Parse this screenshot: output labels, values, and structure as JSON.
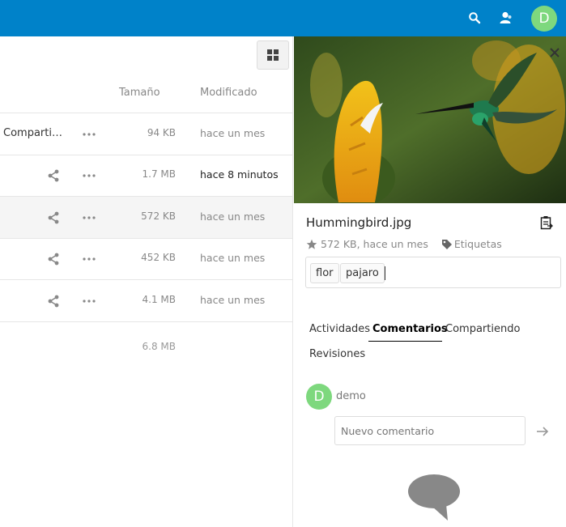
{
  "header": {
    "search_icon": "search-icon",
    "contacts_icon": "contacts-icon",
    "avatar_letter": "D",
    "bg_color": "#0082c9"
  },
  "filelist": {
    "view_toggle_icon": "grid-view-icon",
    "columns": {
      "size": "Tamaño",
      "modified": "Modificado"
    },
    "rows": [
      {
        "share_text": "Comparti…",
        "size": "94 KB",
        "modified": "hace un mes",
        "recent": false
      },
      {
        "share_text": "",
        "size": "1.7 MB",
        "modified": "hace 8 minutos",
        "recent": true
      },
      {
        "share_text": "",
        "size": "572 KB",
        "modified": "hace un mes",
        "recent": false,
        "selected": true
      },
      {
        "share_text": "",
        "size": "452 KB",
        "modified": "hace un mes",
        "recent": false
      },
      {
        "share_text": "",
        "size": "4.1 MB",
        "modified": "hace un mes",
        "recent": false
      }
    ],
    "total_size": "6.8 MB"
  },
  "sidebar": {
    "file_name": "Hummingbird.jpg",
    "meta": "572 KB, hace un mes",
    "tags_label": "Etiquetas",
    "tags": [
      "flor",
      "pajaro"
    ],
    "tabs": [
      "Actividades",
      "Comentarios",
      "Compartiendo",
      "Revisiones"
    ],
    "active_tab": "Comentarios",
    "comment": {
      "avatar_letter": "D",
      "user": "demo",
      "placeholder": "Nuevo comentario"
    }
  }
}
